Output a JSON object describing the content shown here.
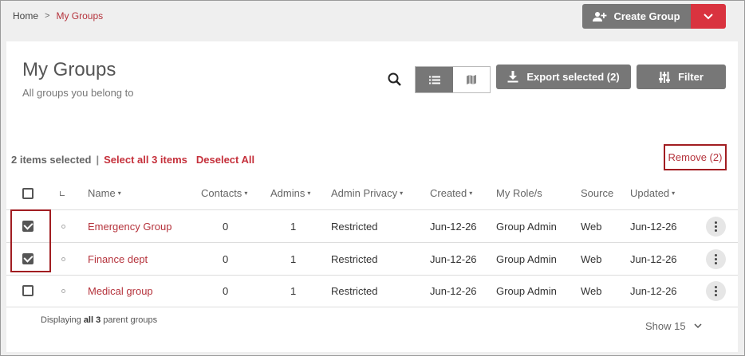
{
  "breadcrumb": {
    "home": "Home",
    "separator": ">",
    "current": "My Groups"
  },
  "create_group": {
    "label": "Create Group",
    "icon": "add-user-icon",
    "caret_icon": "chevron-down-icon"
  },
  "page": {
    "title": "My Groups",
    "subtitle": "All groups you belong to"
  },
  "toolbar": {
    "search_icon": "search-icon",
    "view_list_icon": "list-icon",
    "view_map_icon": "map-icon",
    "export_label": "Export selected (2)",
    "filter_label": "Filter"
  },
  "selection": {
    "count": "2 items selected",
    "separator": "|",
    "select_all": "Select all 3 items",
    "deselect_all": "Deselect All",
    "remove": "Remove (2)"
  },
  "table": {
    "headers": {
      "name": "Name",
      "contacts": "Contacts",
      "admins": "Admins",
      "admin_privacy": "Admin Privacy",
      "created": "Created",
      "my_role": "My Role/s",
      "source": "Source",
      "updated": "Updated"
    },
    "rows": [
      {
        "checked": true,
        "name": "Emergency Group",
        "contacts": "0",
        "admins": "1",
        "privacy": "Restricted",
        "created": "Jun-12-26",
        "role": "Group Admin",
        "source": "Web",
        "updated": "Jun-12-26"
      },
      {
        "checked": true,
        "name": "Finance dept",
        "contacts": "0",
        "admins": "1",
        "privacy": "Restricted",
        "created": "Jun-12-26",
        "role": "Group Admin",
        "source": "Web",
        "updated": "Jun-12-26"
      },
      {
        "checked": false,
        "name": "Medical group",
        "contacts": "0",
        "admins": "1",
        "privacy": "Restricted",
        "created": "Jun-12-26",
        "role": "Group Admin",
        "source": "Web",
        "updated": "Jun-12-26"
      }
    ]
  },
  "footer": {
    "prefix": "Displaying",
    "bold": "all 3",
    "suffix": "parent groups",
    "show": "Show 15"
  },
  "colors": {
    "accent": "#b5333c",
    "button_gray": "#777777",
    "highlight_border": "#a11d21"
  }
}
